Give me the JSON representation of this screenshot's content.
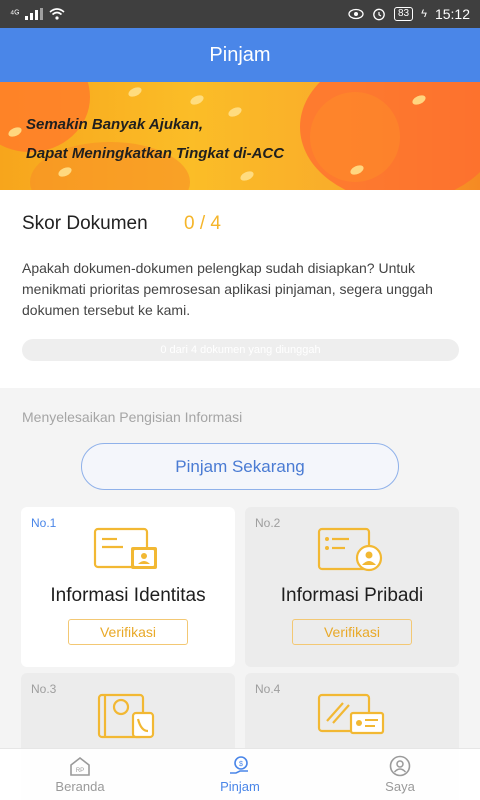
{
  "status_bar": {
    "signal": "⁴ᴳ",
    "battery": "83",
    "time": "15:12"
  },
  "header": {
    "title": "Pinjam"
  },
  "banner": {
    "line1": "Semakin Banyak Ajukan,",
    "line2": "Dapat Meningkatkan Tingkat di-ACC"
  },
  "score": {
    "title": "Skor Dokumen",
    "value": "0 / 4",
    "description": "Apakah dokumen-dokumen pelengkap sudah disiapkan? Untuk menikmati prioritas pemrosesan aplikasi pinjaman, segera unggah dokumen tersebut ke kami.",
    "progress_text": "0 dari 4 dokumen yang diunggah",
    "progress_fraction": 0
  },
  "section": {
    "title": "Menyelesaikan Pengisian Informasi",
    "cta": "Pinjam Sekarang"
  },
  "cards": [
    {
      "no": "No.1",
      "title": "Informasi Identitas",
      "button": "Verifikasi",
      "icon": "id-card-icon"
    },
    {
      "no": "No.2",
      "title": "Informasi Pribadi",
      "button": "Verifikasi",
      "icon": "personal-info-icon"
    },
    {
      "no": "No.3",
      "title": "",
      "button": "",
      "icon": "contact-phone-icon"
    },
    {
      "no": "No.4",
      "title": "",
      "button": "",
      "icon": "bank-card-icon"
    }
  ],
  "nav": [
    {
      "label": "Beranda",
      "icon": "home-icon",
      "active": false
    },
    {
      "label": "Pinjam",
      "icon": "loan-icon",
      "active": true
    },
    {
      "label": "Saya",
      "icon": "profile-icon",
      "active": false
    }
  ],
  "colors": {
    "primary": "#4a86e8",
    "accent": "#f5b52a",
    "status_bar": "#3f3f3f"
  }
}
